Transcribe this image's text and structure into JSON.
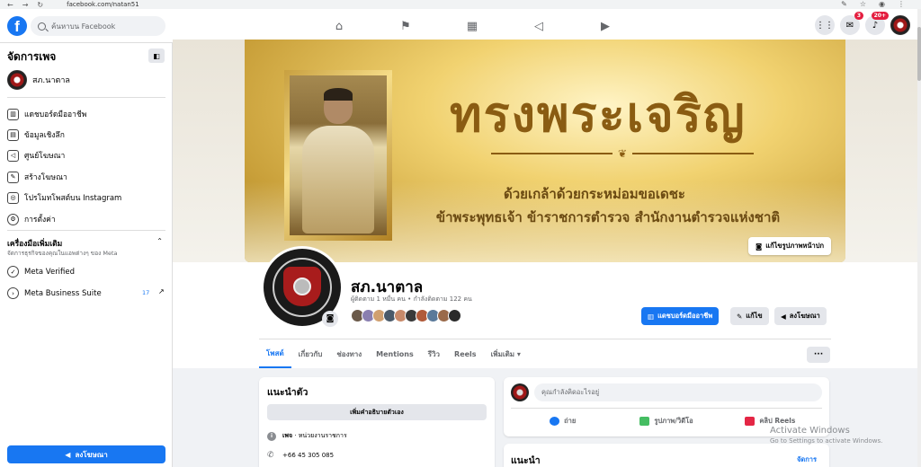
{
  "browser": {
    "url": "facebook.com/natan51",
    "back_icon": "←",
    "forward_icon": "→",
    "reload_icon": "↻"
  },
  "topnav": {
    "search_placeholder": "ค้นหาบน Facebook",
    "logo_letter": "f",
    "messenger_badge": "3",
    "notifications_badge": "20+"
  },
  "sidebar": {
    "title": "จัดการเพจ",
    "page_name": "สภ.นาตาล",
    "items": [
      {
        "label": "แดชบอร์ดมืออาชีพ",
        "icon": "▥"
      },
      {
        "label": "ข้อมูลเชิงลึก",
        "icon": "▤"
      },
      {
        "label": "ศูนย์โฆษณา",
        "icon": "◁"
      },
      {
        "label": "สร้างโฆษณา",
        "icon": "✎"
      },
      {
        "label": "โปรโมทโพสต์บน Instagram",
        "icon": "◎"
      },
      {
        "label": "การตั้งค่า",
        "icon": "⚙"
      }
    ],
    "tools_title": "เครื่องมือเพิ่มเติม",
    "tools_subtitle": "จัดการธุรกิจของคุณในแอพต่างๆ ของ Meta",
    "tools": [
      {
        "label": "Meta Verified",
        "icon": "✓"
      },
      {
        "label": "Meta Business Suite",
        "icon": "›"
      }
    ],
    "business_suite_count": "17",
    "promote_label": "ลงโฆษณา"
  },
  "cover": {
    "title": "ทรงพระเจริญ",
    "line1": "ด้วยเกล้าด้วยกระหม่อมขอเดชะ",
    "line2": "ข้าพระพุทธเจ้า ข้าราชการตำรวจ สำนักงานตำรวจแห่งชาติ",
    "edit_label": "แก้ไขรูปภาพหน้าปก"
  },
  "profile": {
    "name": "สภ.นาตาล",
    "stats": "ผู้ติดตาม 1 หมื่น คน • กำลังติดตาม 122 คน",
    "face_colors": [
      "#6b5a4a",
      "#8a7fb0",
      "#d0a070",
      "#4a5a6a",
      "#c88a6a",
      "#3a3a3a",
      "#b05a3a",
      "#5a7a9a",
      "#9a6a4a",
      "#2a2a2a"
    ]
  },
  "actions": {
    "dashboard": "แดชบอร์ดมืออาชีพ",
    "edit": "แก้ไข",
    "advertise": "ลงโฆษณา"
  },
  "tabs": [
    {
      "label": "โพสต์",
      "active": true
    },
    {
      "label": "เกี่ยวกับ"
    },
    {
      "label": "ช่องทาง"
    },
    {
      "label": "Mentions"
    },
    {
      "label": "รีวิว"
    },
    {
      "label": "Reels"
    },
    {
      "label": "เพิ่มเติม ▾"
    }
  ],
  "intro": {
    "title": "แนะนำตัว",
    "add_bio": "เพิ่มคำอธิบายตัวเอง",
    "category_bold": "เพจ",
    "category": " · หน่วยงานราชการ",
    "phone": "+66 45 305 085"
  },
  "composer": {
    "placeholder": "คุณกำลังคิดอะไรอยู่",
    "live": "ถ่าย",
    "photo": "รูปภาพ/วิดีโอ",
    "reels": "คลิป Reels"
  },
  "recommend": {
    "title": "แนะนำ",
    "manage": "จัดการ"
  },
  "watermark": {
    "line1": "Activate Windows",
    "line2": "Go to Settings to activate Windows."
  },
  "colors": {
    "brand": "#1877f2",
    "cover_gold": "#d9b24a",
    "badge_red": "#e41e3f"
  }
}
